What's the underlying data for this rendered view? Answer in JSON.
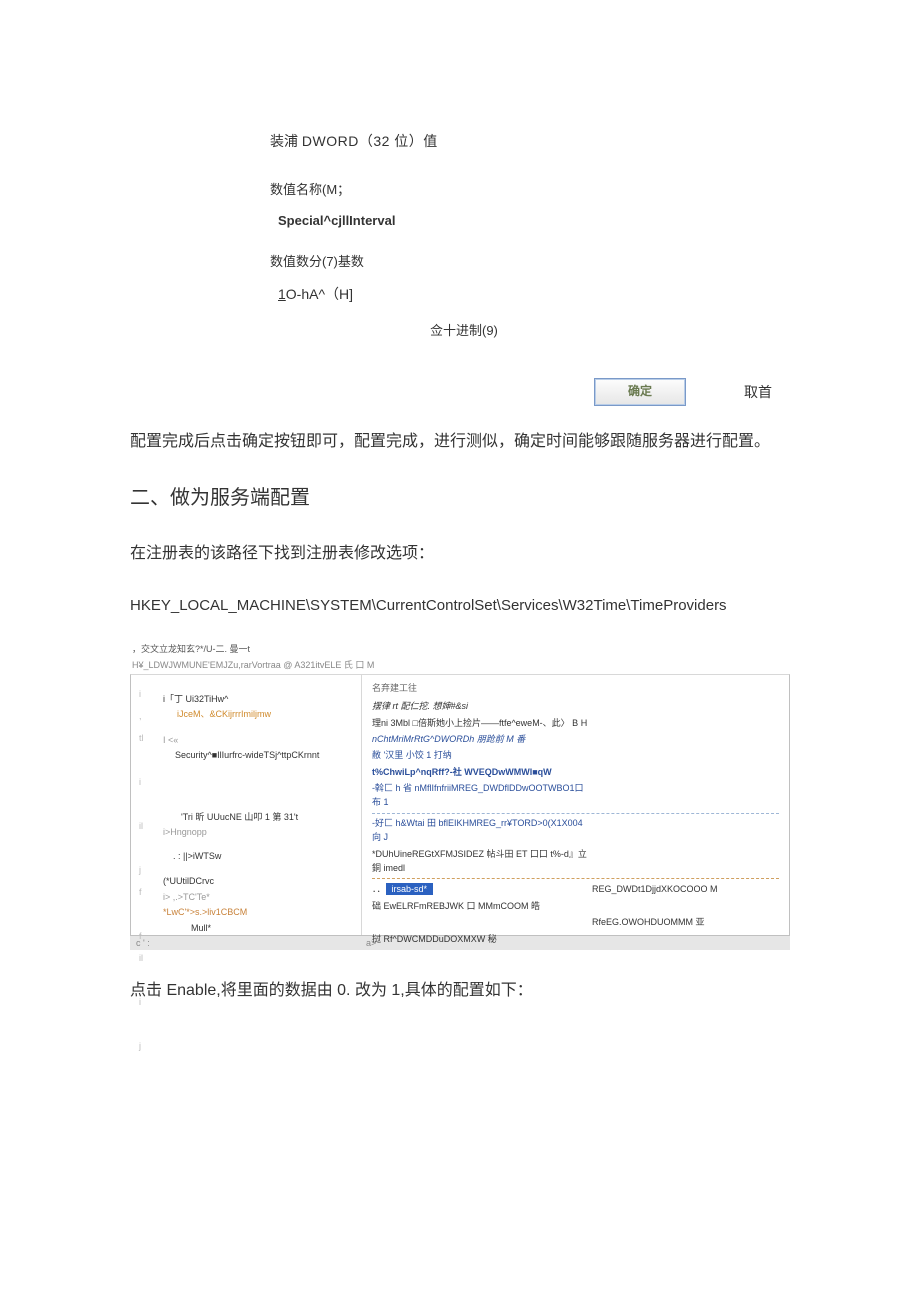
{
  "dialog": {
    "title_pre": "装浦 ",
    "title_en": "DWORD（32 位）值",
    "name_label": "数值名称(M；",
    "name_value": "Special^cjllInterval",
    "data_label": "数值数分(7)基数",
    "data_value_u": "1",
    "data_value_rest": "O-hA^（H]",
    "radix_dec": "佥十进制(9)",
    "ok": "确定",
    "cancel": "取首"
  },
  "para1": "配置完成后点击确定按钮即可，配置完成，进行测似，确定时间能够跟随服务器进行配置。",
  "heading2": "二、做为服务端配置",
  "para2": "在注册表的该路径下找到注册表修改选项：",
  "regpath": "HKEY_LOCAL_MACHINE\\SYSTEM\\CurrentControlSet\\Services\\W32Time\\TimeProviders",
  "reg": {
    "cap_left": "，交文立龙知玄?*/U-二. 曼一t",
    "menu": "H¥_LDWJWMUNE'EMJZu,rarVortraa @ A321itvELE 氏 口 M",
    "tree": {
      "t1": "i「丁 Ui32TiHw^",
      "t1s": "iJceM、&CKijrrrImiljmw",
      "t2a": "I <«",
      "t2b": "Security^■IlIurfrc-wideTSj^ttpCKrnnt",
      "t3": "'Tri 昕 UUucNE 山叩 1 第 31't",
      "t4": "i>Hngnopp",
      "t5": ". :  ||>iWTSw",
      "t6": "(*UUtilDCrvc",
      "t7": "i>  ,.>TC'Te*",
      "t8": "*LwC'*>s.>liv1CBCM",
      "t9": "Mull*"
    },
    "list": {
      "head": "名弃建工往",
      "r1": "摆律 rt 配仁挖. 想婶#&si",
      "r2a": "理ni 3Mbl □倍斯她小上捡片——ftfe^eweM-、此〉 B H",
      "r3": "nChtMriMrRtG^DWORDh 朋跄前 M 番",
      "r4": "敝 '汉里 小饺 1 打纳",
      "r5": "t%ChwiLp^nqRff?-社 WVEQDwWMWl■qW",
      "r6": "-斡匚 h 省 nMflIfnfriiMREG_DWDflDDwOOTWBO1口布 1",
      "r7": "-好匚 h&Wtai 田 bflEIKHMREG_rr¥TORD>0(X1X004 向 J",
      "r8": "*DUhUineREGtXFMJSIDEZ 帖斗田 ET 口口 t%-d』立銅 imedl",
      "hl_name": "irsab-sd*",
      "hl_type": "REG_DWDt1DjjdXKOCOOO M",
      "r10": "础 EwELRFmREBJWK 口 MMmCOOM 皓",
      "r11_t": "RfeEG.OWOHDUOMMM 亚",
      "r12": "挝 Rf^DWCMDDuDOXMXW 秘"
    },
    "status_l": "c ' :",
    "status_m": "a>"
  },
  "para3": "点击 Enable,将里面的数据由 0. 改为 1,具体的配置如下："
}
